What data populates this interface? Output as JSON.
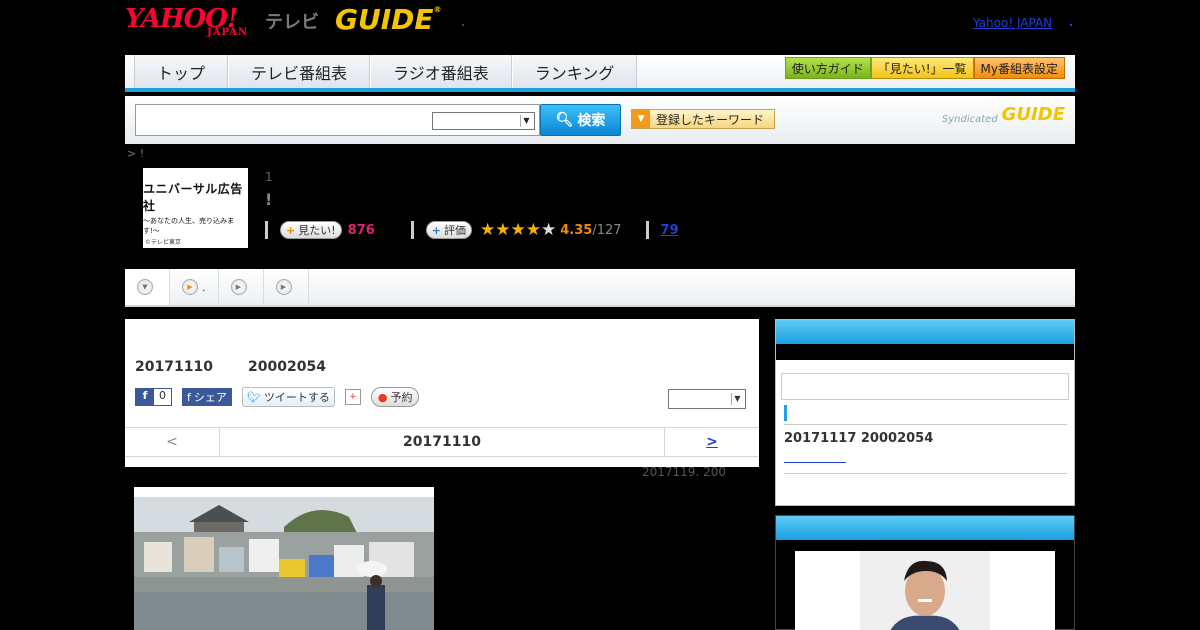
{
  "header": {
    "logo_yahoo": "YAHOO!",
    "logo_japan": "JAPAN",
    "logo_tv": "テレビ",
    "logo_guide": "GUIDE",
    "yahoo_link": "Yahoo! JAPAN"
  },
  "nav": {
    "tabs": [
      "トップ",
      "テレビ番組表",
      "ラジオ番組表",
      "ランキング"
    ],
    "buttons": [
      "使い方ガイド",
      "「見たい!」一覧",
      "My番組表設定"
    ]
  },
  "search": {
    "placeholder": "",
    "button": "検索",
    "keyword_button": "登録したキーワード",
    "syndicated": "Syndicated",
    "syndicated_logo": "GUIDE"
  },
  "breadcrumb": "> !",
  "program": {
    "thumb_title": "ユニバーサル広告社",
    "thumb_sub": "〜あなたの人生、売り込みます!〜",
    "thumb_copy": "©テレビ東京",
    "number": "1",
    "title": "!",
    "mitai_label": "見たい!",
    "mitai_count": "876",
    "rate_label": "評価",
    "rating": 4.35,
    "rating_text": "4.35",
    "votes": "/127",
    "comments": "79"
  },
  "tabs": {
    "items": [
      "",
      ".",
      "",
      ""
    ]
  },
  "episode": {
    "date": "20171110",
    "code": "20002054",
    "fb_like": "0",
    "fb_share": "シェア",
    "tweet": "ツイートする",
    "reserve": "予約",
    "nav_prev": "<",
    "nav_current": "20171110",
    "nav_next": ">",
    "next_air": "2017119. 200"
  },
  "side": {
    "next_episode": "20171117  20002054"
  },
  "colors": {
    "accent": "#1fa1e0",
    "mitai": "#e0226e",
    "score": "#f08a00",
    "link": "#1f3fd6"
  }
}
